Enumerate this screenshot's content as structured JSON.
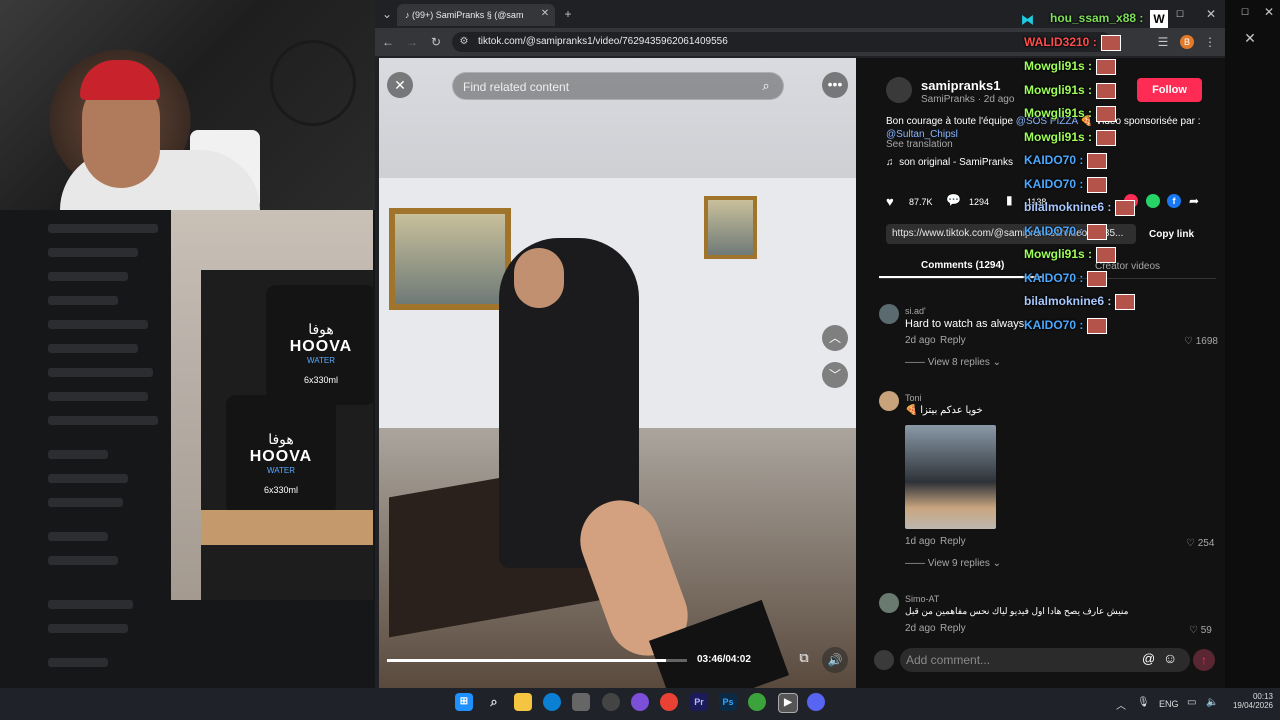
{
  "browser": {
    "tab_title": "(99+) SamiPranks § (@sam",
    "url": "tiktok.com/@samipranks1/video/7629435962061409556"
  },
  "video": {
    "search_placeholder": "Find related content",
    "time": "03:46/04:02",
    "progress": 0.93
  },
  "post": {
    "username": "samipranks1",
    "display_name": "SamiPranks",
    "date": "· 2d ago",
    "follow_label": "Follow",
    "caption_a": "Bon courage à toute l'équipe",
    "caption_mention1": "@SOS PIZZA",
    "caption_b": "🍕 Vidéo sponsorisée par :",
    "caption_mention2": "@Sultan_Chipsl",
    "see_translation": "See translation",
    "sound": "son original - SamiPranks",
    "likes": "87.7K",
    "comments": "1294",
    "saves": "1138",
    "share_url": "https://www.tiktok.com/@samipranks1/video/...435...",
    "copy_link": "Copy link",
    "tab_comments": "Comments (1294)",
    "tab_creator": "Creator videos"
  },
  "comments": [
    {
      "user": "si.ad'",
      "text": "Hard to watch as always",
      "date": "2d ago",
      "reply": "Reply",
      "likes": "1698",
      "view_replies": "View 8 replies"
    },
    {
      "user": "Toni",
      "text": "🍕 خويا عدكم بيتزا",
      "date": "1d ago",
      "reply": "Reply",
      "likes": "254",
      "view_replies": "View 9 replies"
    },
    {
      "user": "Simo-AT",
      "text": "منيش عارف يصح هادا اول فيديو لياك نحس مفاهمين من قبل",
      "date": "2d ago",
      "reply": "Reply",
      "likes": "59"
    }
  ],
  "add_comment_placeholder": "Add comment...",
  "chat": [
    {
      "name": "hou_ssam_x88 :",
      "color": "#7ee05a"
    },
    {
      "name": "WALID3210 :",
      "color": "#ff4d4d"
    },
    {
      "name": "Mowgli91s :",
      "color": "#9fff5a"
    },
    {
      "name": "Mowgli91s :",
      "color": "#9fff5a"
    },
    {
      "name": "Mowgli91s :",
      "color": "#9fff5a"
    },
    {
      "name": "Mowgli91s :",
      "color": "#9fff5a"
    },
    {
      "name": "KAIDO70 :",
      "color": "#4aa8ff"
    },
    {
      "name": "KAIDO70 :",
      "color": "#4aa8ff"
    },
    {
      "name": "bilalmoknine6 :",
      "color": "#a8c8ff"
    },
    {
      "name": "KAIDO70 :",
      "color": "#4aa8ff"
    },
    {
      "name": "Mowgli91s :",
      "color": "#9fff5a"
    },
    {
      "name": "KAIDO70 :",
      "color": "#4aa8ff"
    },
    {
      "name": "bilalmoknine6 :",
      "color": "#a8c8ff"
    },
    {
      "name": "KAIDO70 :",
      "color": "#4aa8ff"
    }
  ],
  "ad": {
    "arabic": "هوفا",
    "brand": "HOOVA",
    "sub": "WATER",
    "size": "6x330ml"
  },
  "taskbar": {
    "lang": "ENG",
    "time": "00:13",
    "date": "19/04/2026"
  },
  "colors": {
    "accent": "#fe2c55",
    "panel_bg": "#121212",
    "browser_bg": "#202124"
  }
}
